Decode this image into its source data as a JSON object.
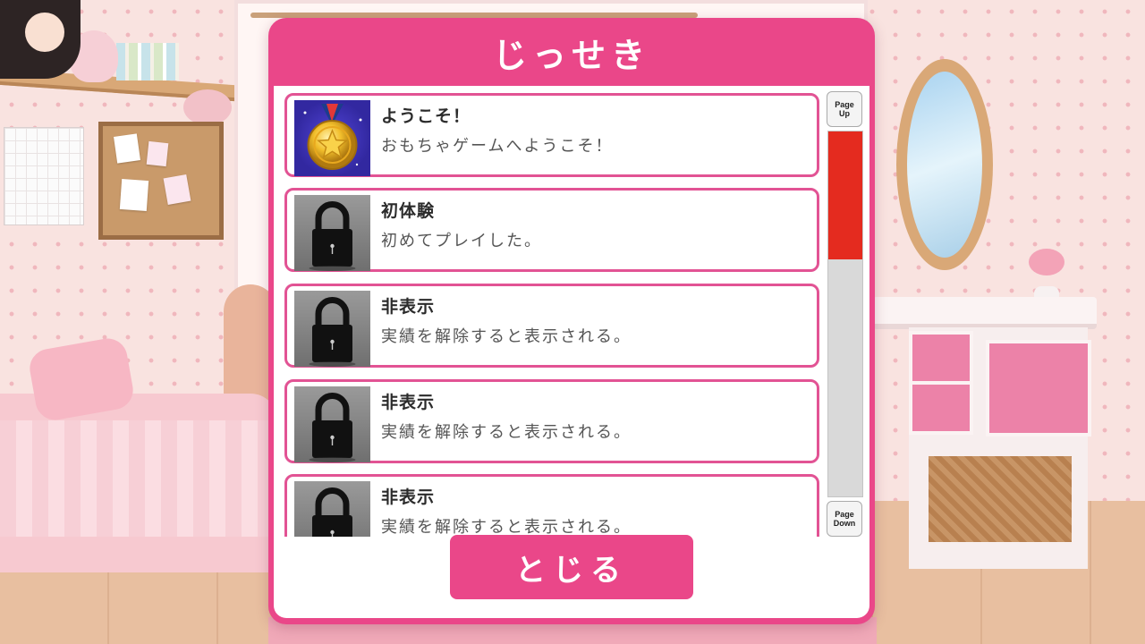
{
  "dialog": {
    "title": "じっせき",
    "close_label": "とじる"
  },
  "achievements": [
    {
      "title": "ようこそ！",
      "description": "おもちゃゲームへようこそ！",
      "icon": "gold-star-medal-icon",
      "unlocked": true
    },
    {
      "title": "初体験",
      "description": "初めてプレイした。",
      "icon": "padlock-icon",
      "unlocked": false
    },
    {
      "title": "非表示",
      "description": "実績を解除すると表示される。",
      "icon": "padlock-icon",
      "unlocked": false
    },
    {
      "title": "非表示",
      "description": "実績を解除すると表示される。",
      "icon": "padlock-icon",
      "unlocked": false
    },
    {
      "title": "非表示",
      "description": "実績を解除すると表示される。",
      "icon": "padlock-icon",
      "unlocked": false
    }
  ],
  "scrollbar": {
    "page_up_label": [
      "Page",
      "Up"
    ],
    "page_down_label": [
      "Page",
      "Down"
    ],
    "thumb_fraction": 0.35,
    "thumb_position": 0
  },
  "colors": {
    "accent": "#ea4789",
    "item_border": "#e25394",
    "scroll_thumb": "#e42b1f",
    "scroll_track": "#d9d9d9"
  }
}
